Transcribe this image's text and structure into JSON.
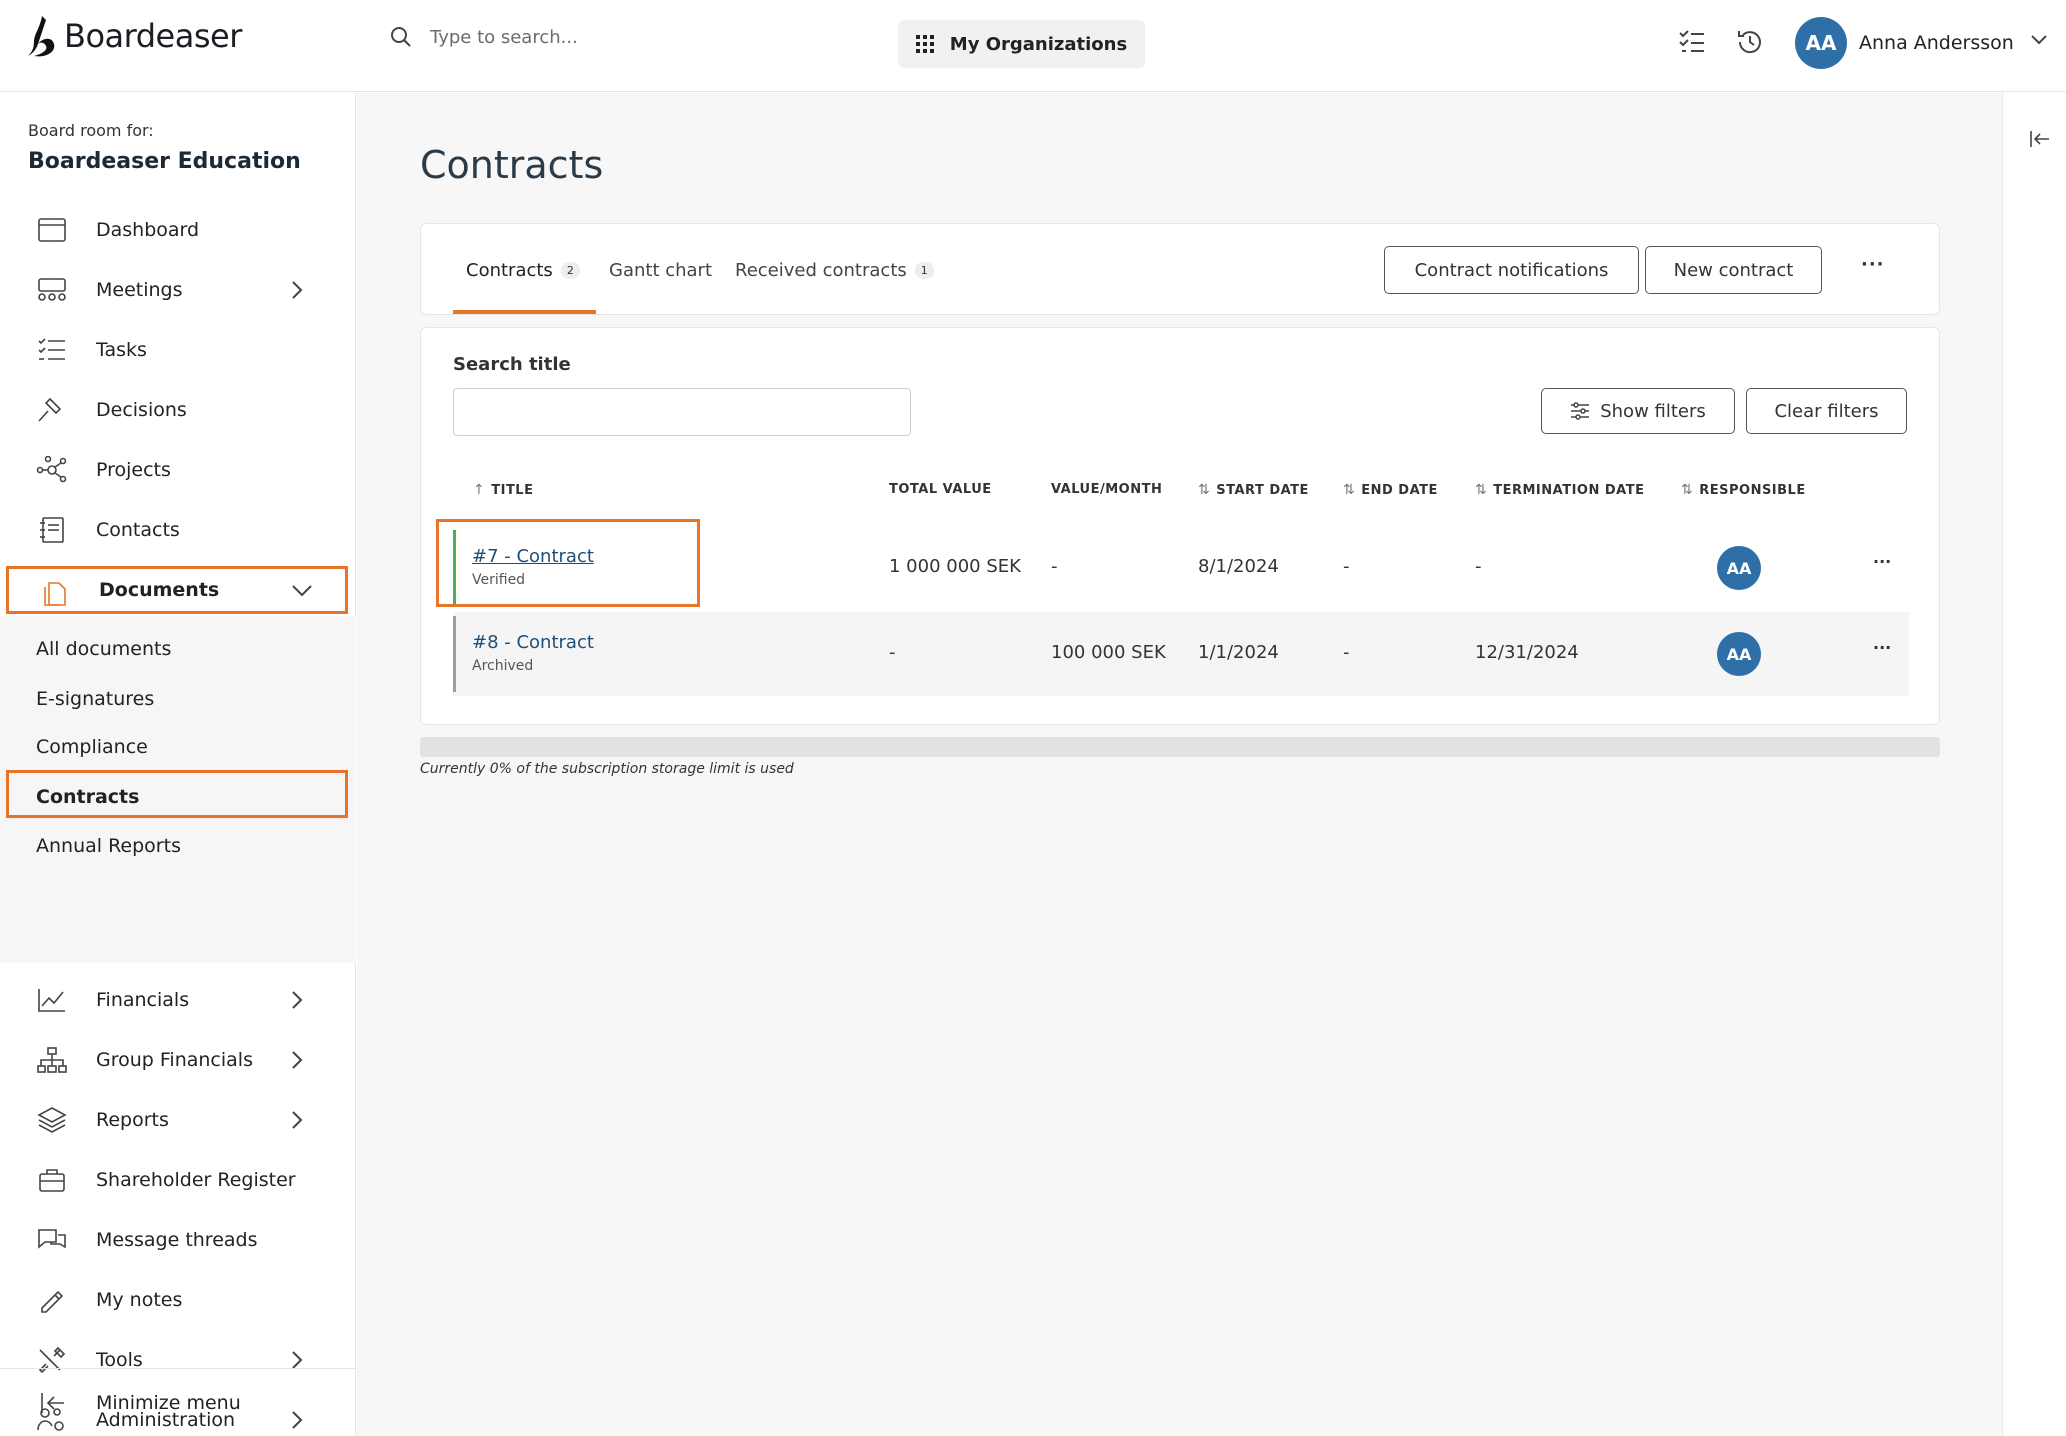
{
  "app": {
    "name": "Boardeaser",
    "search_placeholder": "Type to search...",
    "org_button": "My Organizations",
    "user": {
      "initials": "AA",
      "name": "Anna Andersson"
    }
  },
  "sidebar": {
    "board_for_label": "Board room for:",
    "board_name": "Boardeaser Education",
    "items": [
      {
        "label": "Dashboard",
        "icon": "calendar-icon"
      },
      {
        "label": "Meetings",
        "icon": "meeting-icon",
        "expandable": true
      },
      {
        "label": "Tasks",
        "icon": "checklist-icon"
      },
      {
        "label": "Decisions",
        "icon": "gavel-icon"
      },
      {
        "label": "Projects",
        "icon": "network-icon"
      },
      {
        "label": "Contacts",
        "icon": "address-book-icon"
      },
      {
        "label": "Documents",
        "icon": "documents-icon",
        "expanded": true
      }
    ],
    "documents_sub": [
      "All documents",
      "E-signatures",
      "Compliance",
      "Contracts",
      "Annual Reports"
    ],
    "items_after": [
      {
        "label": "Financials",
        "icon": "line-chart-icon",
        "expandable": true
      },
      {
        "label": "Group Financials",
        "icon": "org-chart-icon",
        "expandable": true
      },
      {
        "label": "Reports",
        "icon": "layers-icon",
        "expandable": true
      },
      {
        "label": "Shareholder Register",
        "icon": "briefcase-icon"
      },
      {
        "label": "Message threads",
        "icon": "chat-icon"
      },
      {
        "label": "My notes",
        "icon": "pencil-icon"
      },
      {
        "label": "Tools",
        "icon": "tools-icon",
        "expandable": true
      },
      {
        "label": "Administration",
        "icon": "users-gear-icon",
        "expandable": true
      }
    ],
    "minimize": "Minimize menu"
  },
  "page": {
    "title": "Contracts",
    "tabs": [
      {
        "label": "Contracts",
        "count": "2",
        "active": true
      },
      {
        "label": "Gantt chart"
      },
      {
        "label": "Received contracts",
        "count": "1"
      }
    ],
    "buttons": {
      "notifications": "Contract notifications",
      "new": "New contract",
      "more": "···"
    },
    "search_label": "Search title",
    "filters": {
      "show": "Show filters",
      "clear": "Clear filters"
    },
    "columns": {
      "title": "TITLE",
      "total_value": "TOTAL VALUE",
      "value_month": "VALUE/MONTH",
      "start_date": "START DATE",
      "end_date": "END DATE",
      "termination_date": "TERMINATION DATE",
      "responsible": "RESPONSIBLE"
    },
    "rows": [
      {
        "title": "#7 - Contract",
        "status": "Verified",
        "total_value": "1 000 000 SEK",
        "value_month": "-",
        "start_date": "8/1/2024",
        "end_date": "-",
        "termination_date": "-",
        "responsible": "AA",
        "status_color": "#4caf50"
      },
      {
        "title": "#8 - Contract",
        "status": "Archived",
        "total_value": "-",
        "value_month": "100 000 SEK",
        "start_date": "1/1/2024",
        "end_date": "-",
        "termination_date": "12/31/2024",
        "responsible": "AA",
        "status_color": "#9e9e9e"
      }
    ],
    "storage_text": "Currently 0% of the subscription storage limit is used",
    "storage_used_fraction": 0
  }
}
